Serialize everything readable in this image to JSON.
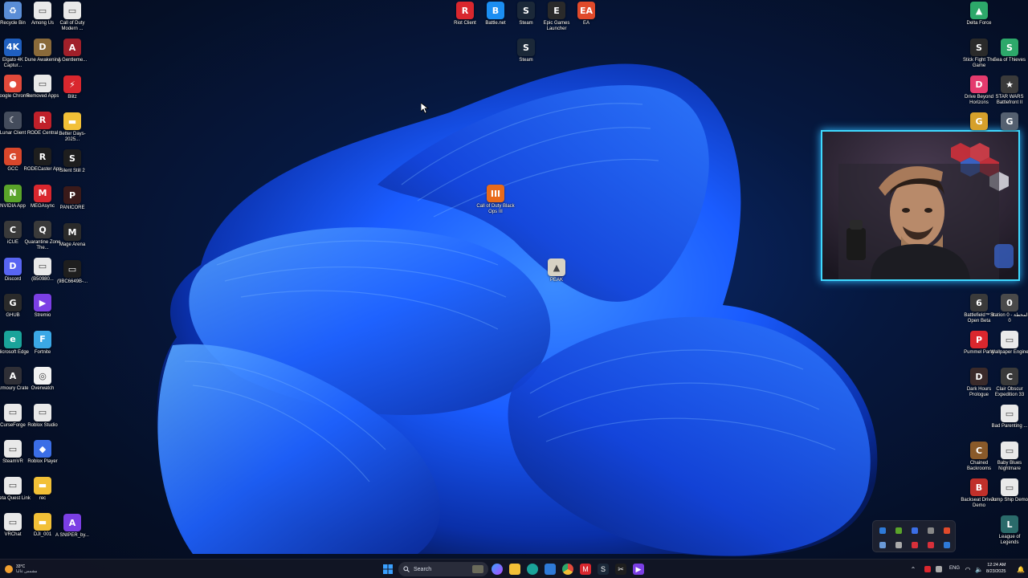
{
  "desktop": {
    "left_col1": [
      {
        "label": "Recycle Bin",
        "icon": "recycle-bin-icon",
        "color": "#5a8dd6",
        "glyph": "♻"
      },
      {
        "label": "Elgato 4K Captur...",
        "icon": "elgato-icon",
        "color": "#1f5fbf",
        "glyph": "4K"
      },
      {
        "label": "Google Chrome",
        "icon": "chrome-icon",
        "color": "#e24a3b",
        "glyph": "●"
      },
      {
        "label": "Lunar Client",
        "icon": "lunar-client-icon",
        "color": "#444c5c",
        "glyph": "☾"
      },
      {
        "label": "GCC",
        "icon": "gcc-icon",
        "color": "#d9472b",
        "glyph": "G"
      },
      {
        "label": "NVIDIA App",
        "icon": "nvidia-icon",
        "color": "#5aa42a",
        "glyph": "N"
      },
      {
        "label": "iCUE",
        "icon": "icue-icon",
        "color": "#3a3a3a",
        "glyph": "C"
      },
      {
        "label": "Discord",
        "icon": "discord-icon",
        "color": "#5865f2",
        "glyph": "D"
      },
      {
        "label": "GHUB",
        "icon": "ghub-icon",
        "color": "#2a2a2a",
        "glyph": "G"
      },
      {
        "label": "Microsoft Edge",
        "icon": "edge-icon",
        "color": "#1aa39a",
        "glyph": "e"
      },
      {
        "label": "Armoury Crate",
        "icon": "armoury-crate-icon",
        "color": "#2f2f36",
        "glyph": "A"
      },
      {
        "label": "CurseForge",
        "icon": "curseforge-icon",
        "color": "#e9e9e9",
        "glyph": "▭"
      },
      {
        "label": "SteamVR",
        "icon": "steamvr-icon",
        "color": "#e9e9e9",
        "glyph": "▭"
      },
      {
        "label": "Meta Quest Link",
        "icon": "meta-quest-icon",
        "color": "#e9e9e9",
        "glyph": "▭"
      },
      {
        "label": "VRChat",
        "icon": "vrchat-icon",
        "color": "#e9e9e9",
        "glyph": "▭"
      }
    ],
    "left_col2": [
      {
        "label": "Among Us",
        "icon": "among-us-icon",
        "color": "#e9e9e9",
        "glyph": "▭"
      },
      {
        "label": "Dune Awakening",
        "icon": "dune-icon",
        "color": "#8a6a3a",
        "glyph": "D"
      },
      {
        "label": "Removed Apps",
        "icon": "removed-apps-icon",
        "color": "#e9e9e9",
        "glyph": "▭"
      },
      {
        "label": "RODE Central",
        "icon": "rode-central-icon",
        "color": "#c0202a",
        "glyph": "R"
      },
      {
        "label": "RODECaster App",
        "icon": "rodecaster-icon",
        "color": "#1e1e1e",
        "glyph": "R"
      },
      {
        "label": "MEGAsync",
        "icon": "megasync-icon",
        "color": "#d9272e",
        "glyph": "M"
      },
      {
        "label": "Quarantine Zone The...",
        "icon": "quarantine-zone-icon",
        "color": "#3a3a3a",
        "glyph": "Q"
      },
      {
        "label": "(B50980...",
        "icon": "file-icon",
        "color": "#e9e9e9",
        "glyph": "▭"
      },
      {
        "label": "Stremio",
        "icon": "stremio-icon",
        "color": "#7b3fe4",
        "glyph": "▶"
      },
      {
        "label": "Fortnite",
        "icon": "fortnite-icon",
        "color": "#3ba8e6",
        "glyph": "F"
      },
      {
        "label": "Overwatch",
        "icon": "overwatch-icon",
        "color": "#f2f2f2",
        "glyph": "◎"
      },
      {
        "label": "Roblox Studio",
        "icon": "roblox-studio-icon",
        "color": "#e9e9e9",
        "glyph": "▭"
      },
      {
        "label": "Roblox Player",
        "icon": "roblox-player-icon",
        "color": "#3b6ee6",
        "glyph": "◆"
      },
      {
        "label": "rec",
        "icon": "folder-icon",
        "color": "#f2c037",
        "glyph": "▬"
      },
      {
        "label": "DJI_001",
        "icon": "folder-icon",
        "color": "#f2c037",
        "glyph": "▬"
      }
    ],
    "left_col3": [
      {
        "label": "Call of Duty Modern ...",
        "icon": "file-icon",
        "color": "#e9e9e9",
        "glyph": "▭"
      },
      {
        "label": "A Gentleme...",
        "icon": "gentleman-game-icon",
        "color": "#a0202a",
        "glyph": "A"
      },
      {
        "label": "Blitz",
        "icon": "blitz-icon",
        "color": "#d9272e",
        "glyph": "⚡"
      },
      {
        "label": "Better Days-2025...",
        "icon": "folder-icon",
        "color": "#f2c037",
        "glyph": "▬"
      },
      {
        "label": "Silent Still 2",
        "icon": "silent-still-icon",
        "color": "#1e1e1e",
        "glyph": "S"
      },
      {
        "label": "PANICORE",
        "icon": "panicore-icon",
        "color": "#3a1a1a",
        "glyph": "P"
      },
      {
        "label": "Mage Arena",
        "icon": "mage-arena-icon",
        "color": "#2a2a2a",
        "glyph": "M"
      },
      {
        "label": "(9BC6649B-...",
        "icon": "file-icon",
        "color": "#1e1e1e",
        "glyph": "▭"
      },
      {
        "label": "A SNIPER_by...",
        "icon": "sniper-icon",
        "color": "#7b3fe4",
        "glyph": "A"
      }
    ],
    "top_center": [
      {
        "label": "Riot Client",
        "icon": "riot-client-icon",
        "color": "#d9272e",
        "glyph": "R"
      },
      {
        "label": "Battle.net",
        "icon": "battlenet-icon",
        "color": "#1b8ef2",
        "glyph": "B"
      },
      {
        "label": "Steam",
        "icon": "steam-icon",
        "color": "#1b2838",
        "glyph": "S"
      },
      {
        "label": "Epic Games Launcher",
        "icon": "epic-games-icon",
        "color": "#2a2a2a",
        "glyph": "E"
      },
      {
        "label": "EA",
        "icon": "ea-icon",
        "color": "#e04a2b",
        "glyph": "EA"
      }
    ],
    "steam_second": {
      "label": "Steam",
      "icon": "steam-icon",
      "color": "#1b2838",
      "glyph": "S"
    },
    "center_icons": [
      {
        "label": "Call of Duty Black Ops III",
        "icon": "black-ops-icon",
        "color": "#e86a1a",
        "glyph": "III"
      },
      {
        "label": "PEAK",
        "icon": "peak-icon",
        "color": "#d7d2c4",
        "glyph": "▲"
      }
    ],
    "right_col1": [
      {
        "label": "Delta Force",
        "icon": "delta-force-icon",
        "color": "#2da86a",
        "glyph": "▲"
      },
      {
        "label": "Stick Fight The Game",
        "icon": "stick-fight-icon",
        "color": "#2a2a2a",
        "glyph": "S"
      },
      {
        "label": "Drive Beyond Horizons",
        "icon": "drive-beyond-icon",
        "color": "#e43b6e",
        "glyph": "D"
      },
      {
        "label": "",
        "icon": "game-icon",
        "color": "#d6a02b",
        "glyph": "G"
      },
      {
        "label": "Battlefield™ 6 Open Beta",
        "icon": "battlefield-icon",
        "color": "#3a3a3a",
        "glyph": "6"
      },
      {
        "label": "Pummel Party",
        "icon": "pummel-party-icon",
        "color": "#d9272e",
        "glyph": "P"
      },
      {
        "label": "Dark Hours Prologue",
        "icon": "dark-hours-icon",
        "color": "#3a2a2a",
        "glyph": "D"
      },
      {
        "label": "Chained Backrooms",
        "icon": "chained-backrooms-icon",
        "color": "#8a5a2a",
        "glyph": "C"
      },
      {
        "label": "Backseat Drivers Demo",
        "icon": "backseat-drivers-icon",
        "color": "#c0302a",
        "glyph": "B"
      }
    ],
    "right_col2": [
      {
        "label": "Sea of Thieves",
        "icon": "sea-of-thieves-icon",
        "color": "#2da86a",
        "glyph": "S"
      },
      {
        "label": "STAR WARS Battlefront II",
        "icon": "battlefront-icon",
        "color": "#3a3a3a",
        "glyph": "★"
      },
      {
        "label": "",
        "icon": "game-icon",
        "color": "#556070",
        "glyph": "G"
      },
      {
        "label": "Station 0 - المحطة 0",
        "icon": "station-icon",
        "color": "#4a4a4a",
        "glyph": "0"
      },
      {
        "label": "Wallpaper Engine",
        "icon": "wallpaper-engine-icon",
        "color": "#e9e9e9",
        "glyph": "▭"
      },
      {
        "label": "Clair Obscur Expedition 33",
        "icon": "clair-obscur-icon",
        "color": "#3a3a3a",
        "glyph": "C"
      },
      {
        "label": "Bad Parenting ...",
        "icon": "file-icon",
        "color": "#e9e9e9",
        "glyph": "▭"
      },
      {
        "label": "Baby Blues Nightmare",
        "icon": "file-icon",
        "color": "#e9e9e9",
        "glyph": "▭"
      },
      {
        "label": "Jump Ship Demo",
        "icon": "file-icon",
        "color": "#e9e9e9",
        "glyph": "▭"
      },
      {
        "label": "League of Legends",
        "icon": "league-icon",
        "color": "#2a6a6a",
        "glyph": "L"
      }
    ]
  },
  "taskbar": {
    "search_label": "Search",
    "weather_temp": "33°C",
    "weather_text": "مشمس غالبا",
    "lang": "ENG",
    "time": "12:24 AM",
    "date": "8/23/2025"
  },
  "colors": {
    "wallpaper_blue": "#1a5cff",
    "webcam_border": "#3fd9ff",
    "taskbar": "#12162a"
  }
}
